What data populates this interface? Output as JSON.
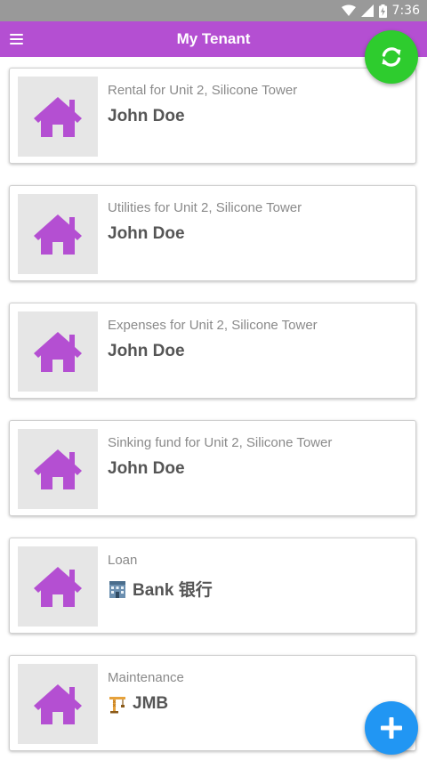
{
  "status_bar": {
    "time": "7:36"
  },
  "app_bar": {
    "title": "My Tenant"
  },
  "colors": {
    "app_bar": "#b44fd2",
    "house_icon": "#b44fd2",
    "refresh_fab": "#2ecc2e",
    "add_fab": "#2196f3",
    "status_bar": "#999999"
  },
  "cards": [
    {
      "subtitle": "Rental for Unit 2, Silicone Tower",
      "title": "John Doe",
      "icon": "house-icon"
    },
    {
      "subtitle": "Utilities for Unit 2, Silicone Tower",
      "title": "John Doe",
      "icon": "house-icon"
    },
    {
      "subtitle": "Expenses for Unit 2, Silicone Tower",
      "title": "John Doe",
      "icon": "house-icon"
    },
    {
      "subtitle": "Sinking fund for Unit 2, Silicone Tower",
      "title": "John Doe",
      "icon": "house-icon"
    },
    {
      "subtitle": "Loan",
      "title": "Bank 银行",
      "icon": "house-icon",
      "lead_icon": "bank-building-icon"
    },
    {
      "subtitle": "Maintenance",
      "title": "JMB",
      "icon": "house-icon",
      "lead_icon": "construction-crane-icon"
    }
  ]
}
